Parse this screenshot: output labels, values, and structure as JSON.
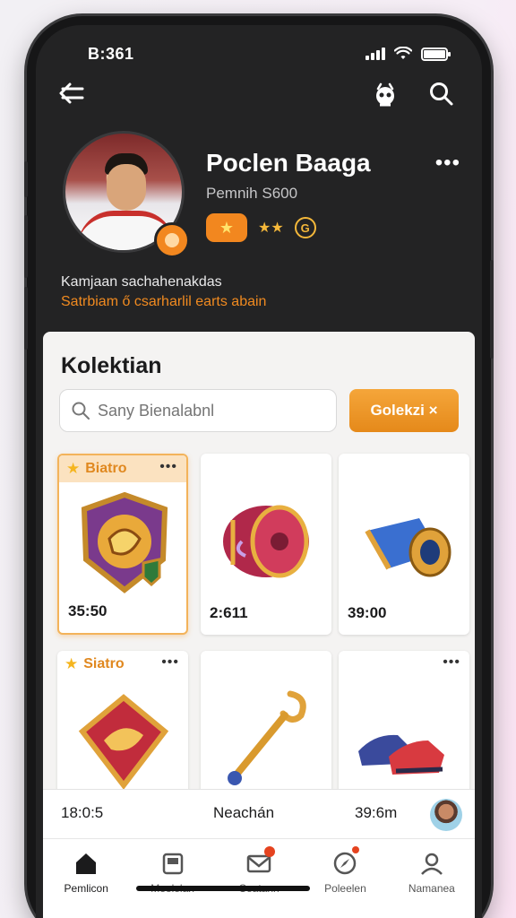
{
  "status": {
    "time": "B:361"
  },
  "profile": {
    "name": "Poclen Baaga",
    "subtitle": "Pemnih S600",
    "stars": "★★",
    "coin_symbol": "G",
    "bio_line1": "Kamjaan sachahenakdas",
    "bio_line2": "Satrbiam ő csarharlil earts abain"
  },
  "collection": {
    "title": "Kolektian",
    "search_placeholder": "Sany Bienalabnl",
    "filter_button": "Golekzi ×",
    "items": [
      {
        "label": "Biatro",
        "price": "35:50",
        "art": "shield-icon"
      },
      {
        "label": "",
        "price": "2:611",
        "art": "drum-icon"
      },
      {
        "label": "",
        "price": "39:00",
        "art": "barrel-icon"
      },
      {
        "label": "Siatro",
        "price": "",
        "art": "tablet-icon"
      },
      {
        "label": "",
        "price": "",
        "art": "staff-icon"
      },
      {
        "label": "",
        "price": "",
        "art": "shoes-icon"
      }
    ]
  },
  "strip": {
    "left": "18:0:5",
    "center": "Neachán",
    "right": "39:6m"
  },
  "tabs": [
    {
      "label": "Pemlicon",
      "icon": "home-icon"
    },
    {
      "label": "Meelelan",
      "icon": "store-icon"
    },
    {
      "label": "Ceatann",
      "icon": "mail-icon"
    },
    {
      "label": "Poleelen",
      "icon": "compass-icon"
    },
    {
      "label": "Namanea",
      "icon": "user-icon"
    }
  ],
  "colors": {
    "accent": "#F2871F",
    "background": "#232324",
    "panel": "#F4F3F2"
  }
}
